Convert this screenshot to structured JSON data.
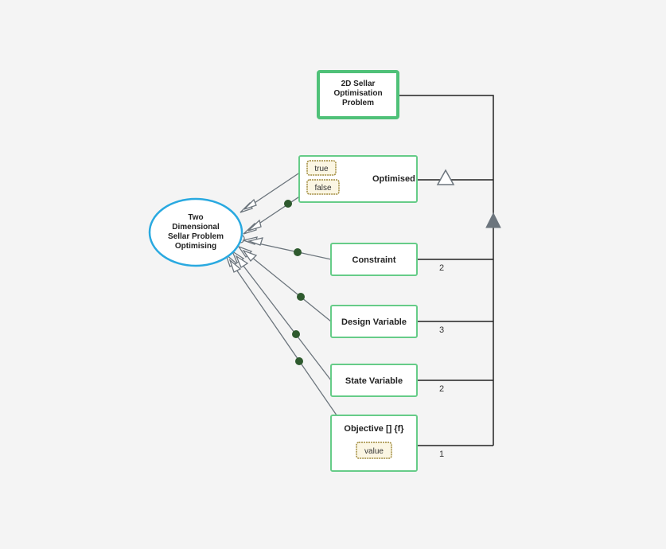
{
  "root": {
    "title_l1": "2D Sellar",
    "title_l2": "Optimisation",
    "title_l3": "Problem"
  },
  "state": {
    "title_l1": "Two",
    "title_l2": "Dimensional",
    "title_l3": "Sellar Problem",
    "title_l4": "Optimising"
  },
  "blocks": {
    "optimised": "Optimised",
    "constraint": "Constraint",
    "design_variable": "Design Variable",
    "state_variable": "State Variable",
    "objective": "Objective [] {f}"
  },
  "tags": {
    "true": "true",
    "false": "false",
    "value": "value"
  },
  "mult": {
    "constraint": "2",
    "design_variable": "3",
    "state_variable": "2",
    "objective": "1"
  }
}
